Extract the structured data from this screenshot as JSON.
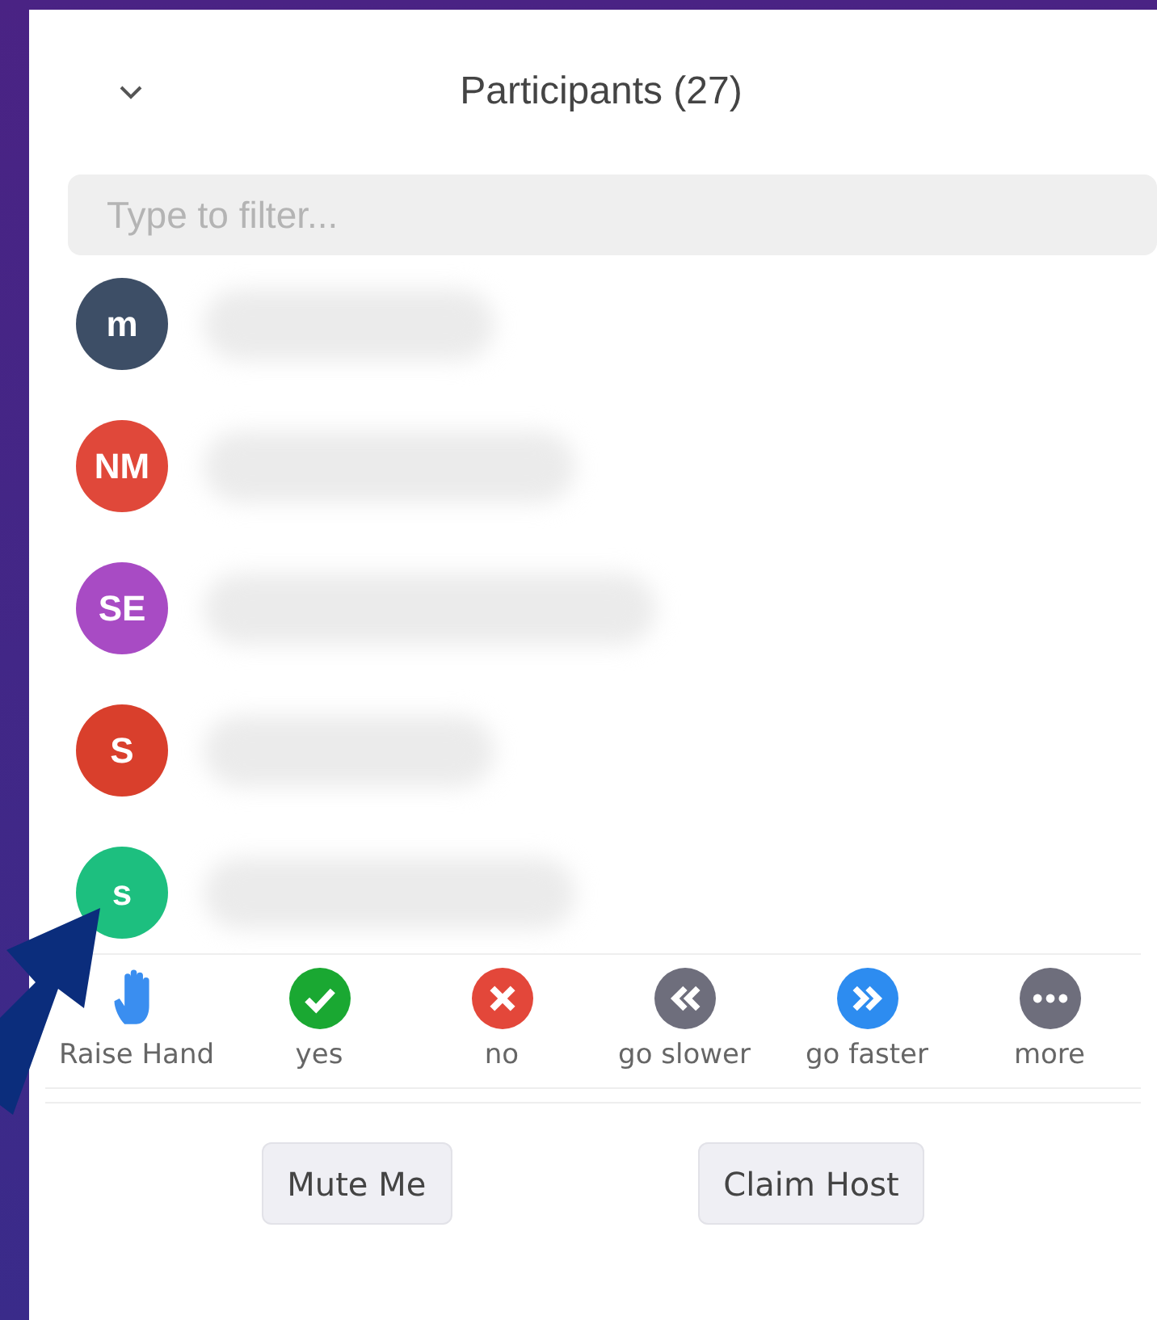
{
  "panel": {
    "title": "Participants (27)",
    "filter": {
      "placeholder": "Type to filter..."
    }
  },
  "participants": [
    {
      "initials": "m",
      "color": "#3d4e66"
    },
    {
      "initials": "NM",
      "color": "#e0483a"
    },
    {
      "initials": "SE",
      "color": "#a84bc4"
    },
    {
      "initials": "S",
      "color": "#d93f2c"
    },
    {
      "initials": "s",
      "color": "#1dbf7f"
    }
  ],
  "reactions": [
    {
      "kind": "hand",
      "label": "Raise Hand",
      "color": "#3a8ef0"
    },
    {
      "kind": "check",
      "label": "yes",
      "color": "#1aa832"
    },
    {
      "kind": "cross",
      "label": "no",
      "color": "#e3473a"
    },
    {
      "kind": "rewind",
      "label": "go slower",
      "color": "#6e6e7c"
    },
    {
      "kind": "forward",
      "label": "go faster",
      "color": "#2d8cf0"
    },
    {
      "kind": "dots",
      "label": "more",
      "color": "#6e6e7c"
    }
  ],
  "buttons": [
    "Mute Me",
    "Claim Host"
  ]
}
